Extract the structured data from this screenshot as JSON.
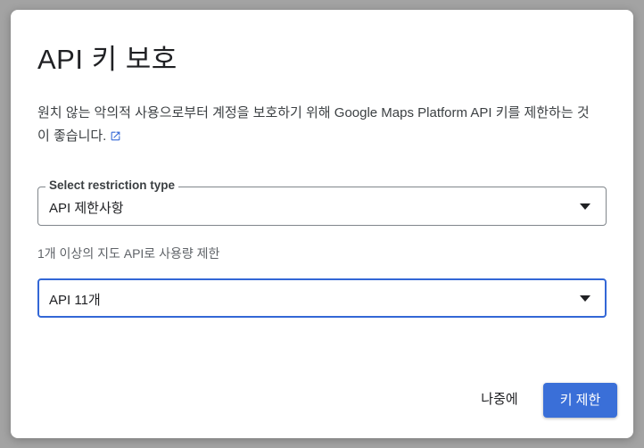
{
  "dialog": {
    "title": "API 키 보호",
    "description": "원치 않는 악의적 사용으로부터 계정을 보호하기 위해 Google Maps Platform API 키를 제한하는 것이 좋습니다.",
    "external_link_icon": "open-in-new-icon",
    "restriction_select": {
      "label": "Select restriction type",
      "value": "API 제한사항",
      "icon": "dropdown-arrow-icon"
    },
    "helper_text": "1개 이상의 지도 API로 사용량 제한",
    "api_select": {
      "value": "API 11개",
      "icon": "dropdown-arrow-icon"
    },
    "buttons": {
      "later": "나중에",
      "restrict_key": "키 제한"
    }
  },
  "colors": {
    "accent": "#3a6fd8",
    "focus_border": "#3367d6",
    "overlay": "#a3a3a3"
  }
}
